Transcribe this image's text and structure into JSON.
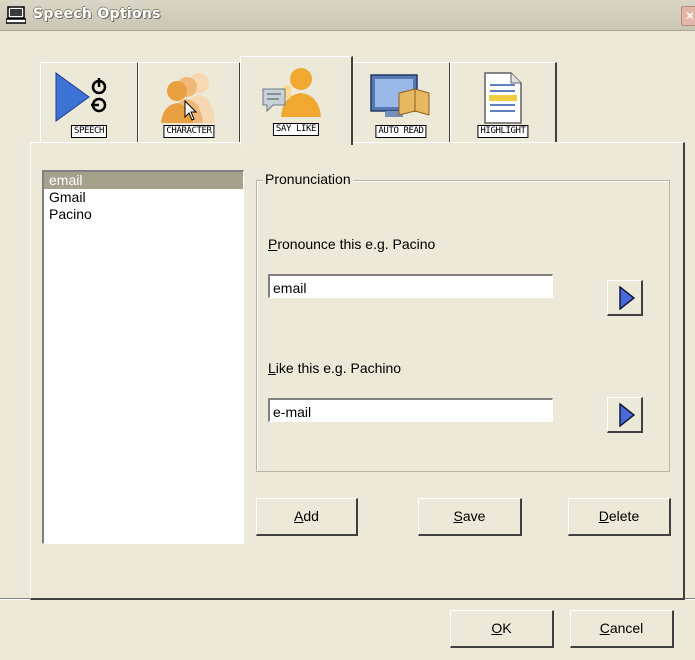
{
  "window": {
    "title": "Speech Options",
    "close_glyph": "×"
  },
  "tabs": [
    {
      "label": "SPEECH",
      "icon": "speech-play-icon",
      "selected": false
    },
    {
      "label": "CHARACTER",
      "icon": "character-people-icon",
      "selected": false
    },
    {
      "label": "SAY LIKE",
      "icon": "say-like-icon",
      "selected": true
    },
    {
      "label": "AUTO READ",
      "icon": "auto-read-icon",
      "selected": false
    },
    {
      "label": "HIGHLIGHT",
      "icon": "highlight-document-icon",
      "selected": false
    }
  ],
  "list": {
    "items": [
      "email",
      "Gmail",
      "Pacino"
    ],
    "selected_index": 0
  },
  "pronunciation": {
    "group_label": "Pronunciation",
    "pronounce_label_key": "P",
    "pronounce_label_rest": "ronounce this e.g. Pacino",
    "pronounce_value": "email",
    "like_label_key": "L",
    "like_label_rest": "ike this e.g. Pachino",
    "like_value": "e-mail"
  },
  "actions": {
    "add_key": "A",
    "add_rest": "dd",
    "save_key": "S",
    "save_rest": "ave",
    "delete_key": "D",
    "delete_rest": "elete"
  },
  "footer": {
    "ok_key": "O",
    "ok_rest": "K",
    "cancel_key": "C",
    "cancel_rest": "ancel"
  },
  "colors": {
    "accent_blue": "#2f62c8",
    "play_fill": "#4b69d8",
    "selection": "#a5a28c"
  }
}
